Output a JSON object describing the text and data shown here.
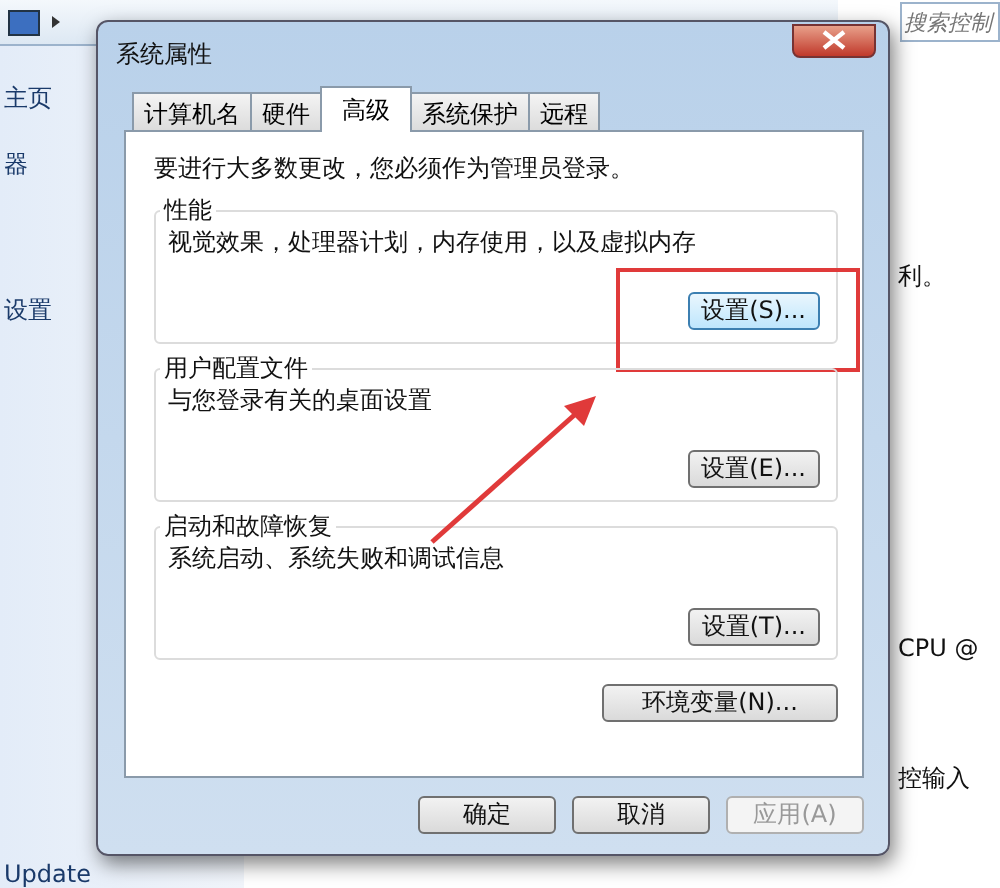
{
  "background_window": {
    "search": {
      "placeholder": "搜索控制"
    },
    "sidebar": [
      "主页",
      "器",
      "设置",
      "Update"
    ],
    "content": [
      "利。",
      "CPU @",
      "控输入"
    ]
  },
  "dialog": {
    "title": "系统属性",
    "tabs": [
      {
        "label": "计算机名",
        "selected": false
      },
      {
        "label": "硬件",
        "selected": false
      },
      {
        "label": "高级",
        "selected": true
      },
      {
        "label": "系统保护",
        "selected": false
      },
      {
        "label": "远程",
        "selected": false
      }
    ],
    "notice": "要进行大多数更改，您必须作为管理员登录。",
    "groups": [
      {
        "title": "性能",
        "description": "视觉效果，处理器计划，内存使用，以及虚拟内存",
        "button": "设置(S)...",
        "highlighted": true
      },
      {
        "title": "用户配置文件",
        "description": "与您登录有关的桌面设置",
        "button": "设置(E)...",
        "highlighted": false
      },
      {
        "title": "启动和故障恢复",
        "description": "系统启动、系统失败和调试信息",
        "button": "设置(T)...",
        "highlighted": false
      }
    ],
    "env_button": "环境变量(N)...",
    "buttons": [
      {
        "label": "确定",
        "disabled": false
      },
      {
        "label": "取消",
        "disabled": false
      },
      {
        "label": "应用(A)",
        "disabled": true
      }
    ]
  }
}
